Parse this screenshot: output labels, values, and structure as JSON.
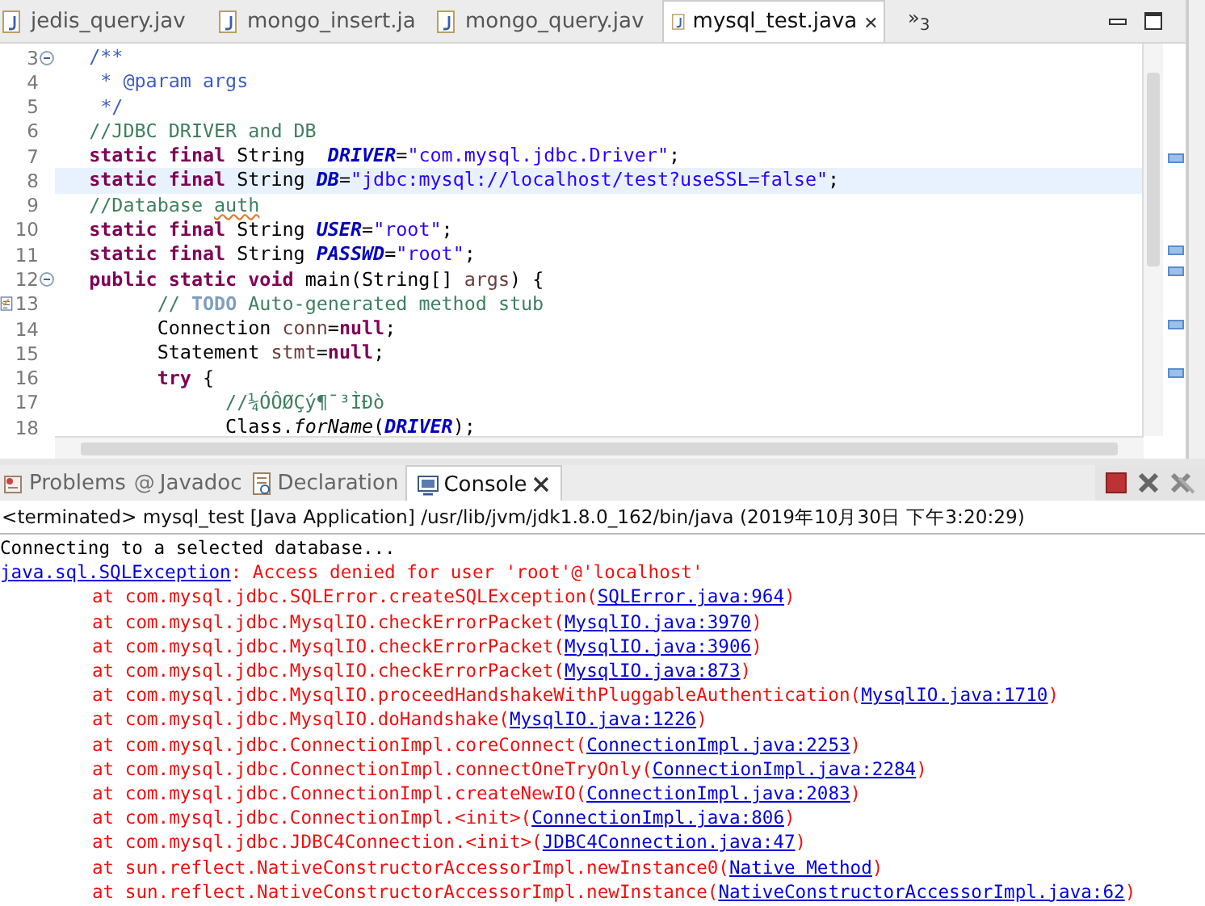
{
  "editor_tabs": [
    {
      "label": "jedis_query.jav",
      "selected": false
    },
    {
      "label": "mongo_insert.ja",
      "selected": false
    },
    {
      "label": "mongo_query.jav",
      "selected": false
    },
    {
      "label": "mysql_test.java",
      "selected": true
    }
  ],
  "editor_overflow": "»$_{3}$",
  "code_lines": [
    {
      "number": "3",
      "fold": true,
      "task": false,
      "current": false,
      "tokens": [
        {
          "kind": "javadoc",
          "text": "   /**"
        }
      ]
    },
    {
      "number": "4",
      "fold": false,
      "task": false,
      "current": false,
      "tokens": [
        {
          "kind": "javadoc",
          "text": "    * @param args"
        }
      ]
    },
    {
      "number": "5",
      "fold": false,
      "task": false,
      "current": false,
      "tokens": [
        {
          "kind": "javadoc",
          "text": "    */"
        }
      ]
    },
    {
      "number": "6",
      "fold": false,
      "task": false,
      "current": false,
      "tokens": [
        {
          "kind": "comment",
          "text": "   //JDBC DRIVER and DB"
        }
      ]
    },
    {
      "number": "7",
      "fold": false,
      "task": false,
      "current": false,
      "tokens": [
        {
          "kind": "keyword",
          "text": "   static final"
        },
        {
          "kind": "plain",
          "text": " String  "
        },
        {
          "kind": "field",
          "text": "DRIVER"
        },
        {
          "kind": "plain",
          "text": "="
        },
        {
          "kind": "string",
          "text": "\"com.mysql.jdbc.Driver\""
        },
        {
          "kind": "plain",
          "text": ";"
        }
      ]
    },
    {
      "number": "8",
      "fold": false,
      "task": false,
      "current": true,
      "tokens": [
        {
          "kind": "keyword",
          "text": "   static final"
        },
        {
          "kind": "plain",
          "text": " String "
        },
        {
          "kind": "field",
          "text": "DB"
        },
        {
          "kind": "plain",
          "text": "="
        },
        {
          "kind": "string",
          "text": "\"jdbc:mysql://localhost/test?useSSL=false\""
        },
        {
          "kind": "plain",
          "text": ";"
        }
      ]
    },
    {
      "number": "9",
      "fold": false,
      "task": false,
      "current": false,
      "tokens": [
        {
          "kind": "comment",
          "text": "   //Database "
        },
        {
          "kind": "misspelled",
          "text": "auth"
        }
      ]
    },
    {
      "number": "10",
      "fold": false,
      "task": false,
      "current": false,
      "tokens": [
        {
          "kind": "keyword",
          "text": "   static final"
        },
        {
          "kind": "plain",
          "text": " String "
        },
        {
          "kind": "field",
          "text": "USER"
        },
        {
          "kind": "plain",
          "text": "="
        },
        {
          "kind": "string",
          "text": "\"root\""
        },
        {
          "kind": "plain",
          "text": ";"
        }
      ]
    },
    {
      "number": "11",
      "fold": false,
      "task": false,
      "current": false,
      "tokens": [
        {
          "kind": "keyword",
          "text": "   static final"
        },
        {
          "kind": "plain",
          "text": " String "
        },
        {
          "kind": "field",
          "text": "PASSWD"
        },
        {
          "kind": "plain",
          "text": "="
        },
        {
          "kind": "string",
          "text": "\"root\""
        },
        {
          "kind": "plain",
          "text": ";"
        }
      ]
    },
    {
      "number": "12",
      "fold": true,
      "task": false,
      "current": false,
      "tokens": [
        {
          "kind": "keyword",
          "text": "   public static void"
        },
        {
          "kind": "plain",
          "text": " main(String[] "
        },
        {
          "kind": "variable",
          "text": "args"
        },
        {
          "kind": "plain",
          "text": ") {"
        }
      ]
    },
    {
      "number": "13",
      "fold": false,
      "task": true,
      "current": false,
      "tokens": [
        {
          "kind": "comment",
          "text": "         // "
        },
        {
          "kind": "todo",
          "text": "TODO"
        },
        {
          "kind": "comment",
          "text": " Auto-generated method stub"
        }
      ]
    },
    {
      "number": "14",
      "fold": false,
      "task": false,
      "current": false,
      "tokens": [
        {
          "kind": "plain",
          "text": "         Connection "
        },
        {
          "kind": "variable",
          "text": "conn"
        },
        {
          "kind": "plain",
          "text": "="
        },
        {
          "kind": "keyword",
          "text": "null"
        },
        {
          "kind": "plain",
          "text": ";"
        }
      ]
    },
    {
      "number": "15",
      "fold": false,
      "task": false,
      "current": false,
      "tokens": [
        {
          "kind": "plain",
          "text": "         Statement "
        },
        {
          "kind": "variable",
          "text": "stmt"
        },
        {
          "kind": "plain",
          "text": "="
        },
        {
          "kind": "keyword",
          "text": "null"
        },
        {
          "kind": "plain",
          "text": ";"
        }
      ]
    },
    {
      "number": "16",
      "fold": false,
      "task": false,
      "current": false,
      "tokens": [
        {
          "kind": "keyword",
          "text": "         try"
        },
        {
          "kind": "plain",
          "text": " {"
        }
      ]
    },
    {
      "number": "17",
      "fold": false,
      "task": false,
      "current": false,
      "tokens": [
        {
          "kind": "comment",
          "text": "               //¼ÓÔØÇý¶¯³ÌÐò"
        }
      ]
    },
    {
      "number": "18",
      "fold": false,
      "task": false,
      "current": false,
      "tokens": [
        {
          "kind": "plain",
          "text": "               Class."
        },
        {
          "kind": "static",
          "text": "forName"
        },
        {
          "kind": "plain",
          "text": "("
        },
        {
          "kind": "field",
          "text": "DRIVER"
        },
        {
          "kind": "plain",
          "text": ");"
        }
      ]
    }
  ],
  "view_tabs": [
    {
      "kind": "problems",
      "label": "Problems",
      "selected": false
    },
    {
      "kind": "javadoc",
      "icon": "@",
      "label": "Javadoc",
      "selected": false
    },
    {
      "kind": "declaration",
      "label": "Declaration",
      "selected": false
    },
    {
      "kind": "console",
      "label": "Console",
      "selected": true
    }
  ],
  "console": {
    "header": "<terminated> mysql_test [Java Application] /usr/lib/jvm/jdk1.8.0_162/bin/java (2019年10月30日 下午3:20:29)",
    "lines": [
      {
        "kind": "output",
        "tokens": [
          {
            "text": "Connecting to a selected database...",
            "link": false
          }
        ]
      },
      {
        "kind": "error",
        "tokens": [
          {
            "text": "java.sql.SQLException",
            "link": true
          },
          {
            "text": ": Access denied for user 'root'@'localhost'",
            "link": false
          }
        ]
      },
      {
        "kind": "frame",
        "tokens": [
          {
            "text": "at com.mysql.jdbc.SQLError.createSQLException(",
            "link": false
          },
          {
            "text": "SQLError.java:964",
            "link": true
          },
          {
            "text": ")",
            "link": false
          }
        ]
      },
      {
        "kind": "frame",
        "tokens": [
          {
            "text": "at com.mysql.jdbc.MysqlIO.checkErrorPacket(",
            "link": false
          },
          {
            "text": "MysqlIO.java:3970",
            "link": true
          },
          {
            "text": ")",
            "link": false
          }
        ]
      },
      {
        "kind": "frame",
        "tokens": [
          {
            "text": "at com.mysql.jdbc.MysqlIO.checkErrorPacket(",
            "link": false
          },
          {
            "text": "MysqlIO.java:3906",
            "link": true
          },
          {
            "text": ")",
            "link": false
          }
        ]
      },
      {
        "kind": "frame",
        "tokens": [
          {
            "text": "at com.mysql.jdbc.MysqlIO.checkErrorPacket(",
            "link": false
          },
          {
            "text": "MysqlIO.java:873",
            "link": true
          },
          {
            "text": ")",
            "link": false
          }
        ]
      },
      {
        "kind": "frame",
        "tokens": [
          {
            "text": "at com.mysql.jdbc.MysqlIO.proceedHandshakeWithPluggableAuthentication(",
            "link": false
          },
          {
            "text": "MysqlIO.java:1710",
            "link": true
          },
          {
            "text": ")",
            "link": false
          }
        ]
      },
      {
        "kind": "frame",
        "tokens": [
          {
            "text": "at com.mysql.jdbc.MysqlIO.doHandshake(",
            "link": false
          },
          {
            "text": "MysqlIO.java:1226",
            "link": true
          },
          {
            "text": ")",
            "link": false
          }
        ]
      },
      {
        "kind": "frame",
        "tokens": [
          {
            "text": "at com.mysql.jdbc.ConnectionImpl.coreConnect(",
            "link": false
          },
          {
            "text": "ConnectionImpl.java:2253",
            "link": true
          },
          {
            "text": ")",
            "link": false
          }
        ]
      },
      {
        "kind": "frame",
        "tokens": [
          {
            "text": "at com.mysql.jdbc.ConnectionImpl.connectOneTryOnly(",
            "link": false
          },
          {
            "text": "ConnectionImpl.java:2284",
            "link": true
          },
          {
            "text": ")",
            "link": false
          }
        ]
      },
      {
        "kind": "frame",
        "tokens": [
          {
            "text": "at com.mysql.jdbc.ConnectionImpl.createNewIO(",
            "link": false
          },
          {
            "text": "ConnectionImpl.java:2083",
            "link": true
          },
          {
            "text": ")",
            "link": false
          }
        ]
      },
      {
        "kind": "frame",
        "tokens": [
          {
            "text": "at com.mysql.jdbc.ConnectionImpl.<init>(",
            "link": false
          },
          {
            "text": "ConnectionImpl.java:806",
            "link": true
          },
          {
            "text": ")",
            "link": false
          }
        ]
      },
      {
        "kind": "frame",
        "tokens": [
          {
            "text": "at com.mysql.jdbc.JDBC4Connection.<init>(",
            "link": false
          },
          {
            "text": "JDBC4Connection.java:47",
            "link": true
          },
          {
            "text": ")",
            "link": false
          }
        ]
      },
      {
        "kind": "frame",
        "tokens": [
          {
            "text": "at sun.reflect.NativeConstructorAccessorImpl.newInstance0(",
            "link": false
          },
          {
            "text": "Native Method",
            "link": true
          },
          {
            "text": ")",
            "link": false
          }
        ]
      },
      {
        "kind": "frame",
        "tokens": [
          {
            "text": "at sun.reflect.NativeConstructorAccessorImpl.newInstance(",
            "link": false
          },
          {
            "text": "NativeConstructorAccessorImpl.java:62",
            "link": true
          },
          {
            "text": ")",
            "link": false
          }
        ]
      }
    ]
  }
}
